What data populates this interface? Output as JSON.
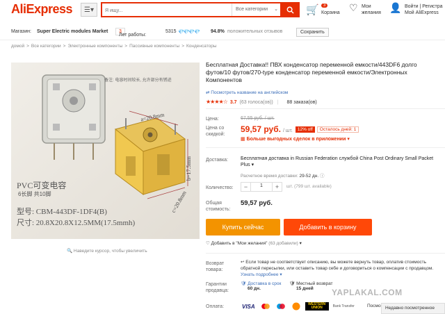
{
  "header": {
    "logo": "AliExpress",
    "search_placeholder": "Я ищу...",
    "category_select": "Все категории",
    "cart_count": "3",
    "cart_label": "Корзина",
    "wishlist_line1": "Мои",
    "wishlist_line2": "желания",
    "account_line1": "Войти | Регистра",
    "account_line2": "Мой AliExpress"
  },
  "store": {
    "label": "Магазин:",
    "name": "Super Electric modules Market",
    "years_label": "Лет работы:",
    "years_value": "3",
    "score": "5315",
    "feedback_pct": "94.8%",
    "feedback_label": "положительных отзывов",
    "save_label": "Сохранить"
  },
  "breadcrumb": [
    "домой",
    "Все категории",
    "Электронные компоненты",
    "Пассивные компоненты",
    "Конденсаторы"
  ],
  "image": {
    "caption_cn": "PVC可变电容",
    "caption_pins": "6长脚 共10脚",
    "caption_model": "型号: CBM-443DF-1DF4(B)",
    "caption_size": "尺寸: 20.8X20.8X12.5MM(17.5mmh)",
    "note": "备注: 电容时间较长, 允许部分有锈迹",
    "dim_a": "a=20.8mm",
    "dim_b": "b=17.5mm",
    "dim_c": "c=20.8mm",
    "zoom_hint": "Наведите курсор, чтобы увеличить"
  },
  "product": {
    "title": "Бесплатная Доставка!! ПВХ конденсатор переменной емкости/443DF6 долго футов/10 футов/270-type конденсатор переменной емкости/Электронных Компонентов",
    "translate_link": "Посмотреть название на английском",
    "rating": 3.7,
    "rating_stars": "★★★★☆",
    "rating_text": "3.7",
    "votes": "(63 голоса(ов))",
    "orders": "88 заказа(ов)",
    "price_label": "Цена:",
    "old_price": "67,55 руб. / шт.",
    "discount_label_1": "Цена со",
    "discount_label_2": "скидкой:",
    "new_price": "59,57 руб.",
    "per_unit": "/ шт.",
    "discount_badge": "12% off",
    "days_left": "Осталось дней: 1",
    "deals_link": "Больше выгодных сделок в приложении",
    "shipping_label": "Доставка:",
    "shipping_text": "Бесплатная доставка in Russian Federation службой China Post Ordinary Small Packet Plus",
    "shipping_time_label": "Расчетное время доставки:",
    "shipping_time": "29-52 дн.",
    "qty_label": "Количество:",
    "qty_value": "1",
    "qty_avail": "шт. (799 шт. available)",
    "total_label_1": "Общая",
    "total_label_2": "стоимость:",
    "total_value": "59,57 руб.",
    "buy_now": "Купить сейчас",
    "add_to_cart": "Добавить в корзину",
    "add_wish": "Добавить в \"Мои желания\"",
    "add_wish_count": "(63 добавили)"
  },
  "service": {
    "returns_label_1": "Возврат",
    "returns_label_2": "товара:",
    "returns_text": "Если товар не соответствует описанию, вы можете вернуть товар, оплатив стоимость обратной пересылки, или оставить товар себе и договориться о компенсации с продавцом.",
    "returns_link": "Узнать подробнее",
    "guarantee_label_1": "Гарантии",
    "guarantee_label_2": "продавца:",
    "guarantee1_label": "Доставка в срок",
    "guarantee1_value": "60 дн.",
    "guarantee2_label": "Местный возврат",
    "guarantee2_value": "15 дней",
    "payment_label": "Оплата:",
    "payment_methods": [
      "VISA",
      "MasterCard",
      "Maestro",
      "QIWI",
      "WESTERN UNION",
      "Bank Transfer"
    ],
    "payment_more": "Посмо"
  },
  "watermark": "YAPLAKAL.COM",
  "recently_viewed": "Недавно посмотренное",
  "colors": {
    "brand": "#e62e04",
    "buy_now": "#f39300",
    "add_to_cart": "#ff4808",
    "link": "#3a6db8"
  }
}
